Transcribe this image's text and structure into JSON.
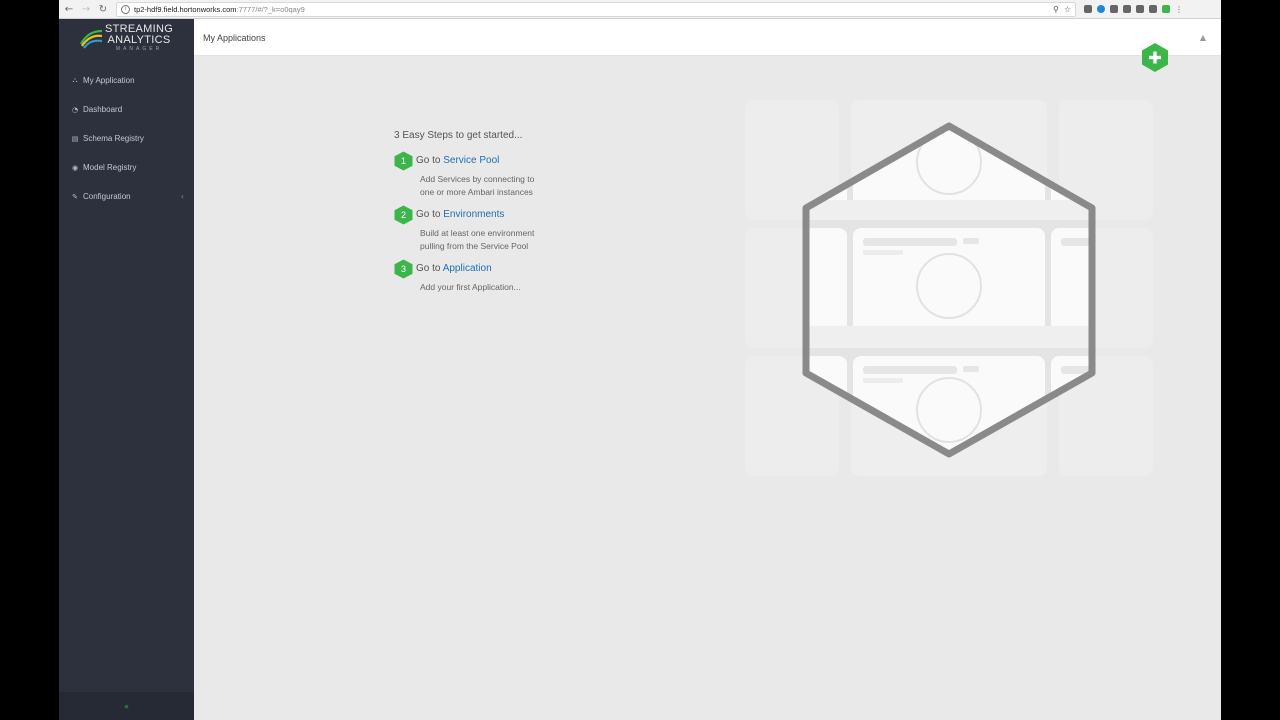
{
  "browser": {
    "url_host": "tp2-hdf9.field.hortonworks.com",
    "url_rest": ":7777/#/?_k=o0qay9"
  },
  "brand": {
    "line1": "STREAMING",
    "line2": "ANALYTICS",
    "line3": "MANAGER"
  },
  "sidebar": {
    "items": [
      {
        "label": "My Application",
        "icon": "sitemap-icon",
        "glyph": "⛬"
      },
      {
        "label": "Dashboard",
        "icon": "dashboard-icon",
        "glyph": "◔"
      },
      {
        "label": "Schema Registry",
        "icon": "file-icon",
        "glyph": "▤"
      },
      {
        "label": "Model Registry",
        "icon": "cube-icon",
        "glyph": "◉"
      },
      {
        "label": "Configuration",
        "icon": "wrench-icon",
        "glyph": "✎"
      }
    ],
    "configuration_caret": "‹",
    "footer_glyph": "«"
  },
  "header": {
    "title": "My Applications",
    "user_glyph": "▲"
  },
  "getting_started": {
    "heading": "3 Easy Steps to get started...",
    "steps": [
      {
        "num": "1",
        "prefix": "Go to",
        "link": "Service Pool",
        "desc_line1": "Add Services by connecting to",
        "desc_line2": "one or more Ambari instances"
      },
      {
        "num": "2",
        "prefix": "Go to",
        "link": "Environments",
        "desc_line1": "Build at least one environment",
        "desc_line2": "pulling from the Service Pool"
      },
      {
        "num": "3",
        "prefix": "Go to",
        "link": "Application",
        "desc_line1": "Add your first Application...",
        "desc_line2": ""
      }
    ]
  },
  "colors": {
    "accent_green": "#3cb54a",
    "link_blue": "#1f6fb3",
    "sidebar_bg": "#2c313d"
  }
}
